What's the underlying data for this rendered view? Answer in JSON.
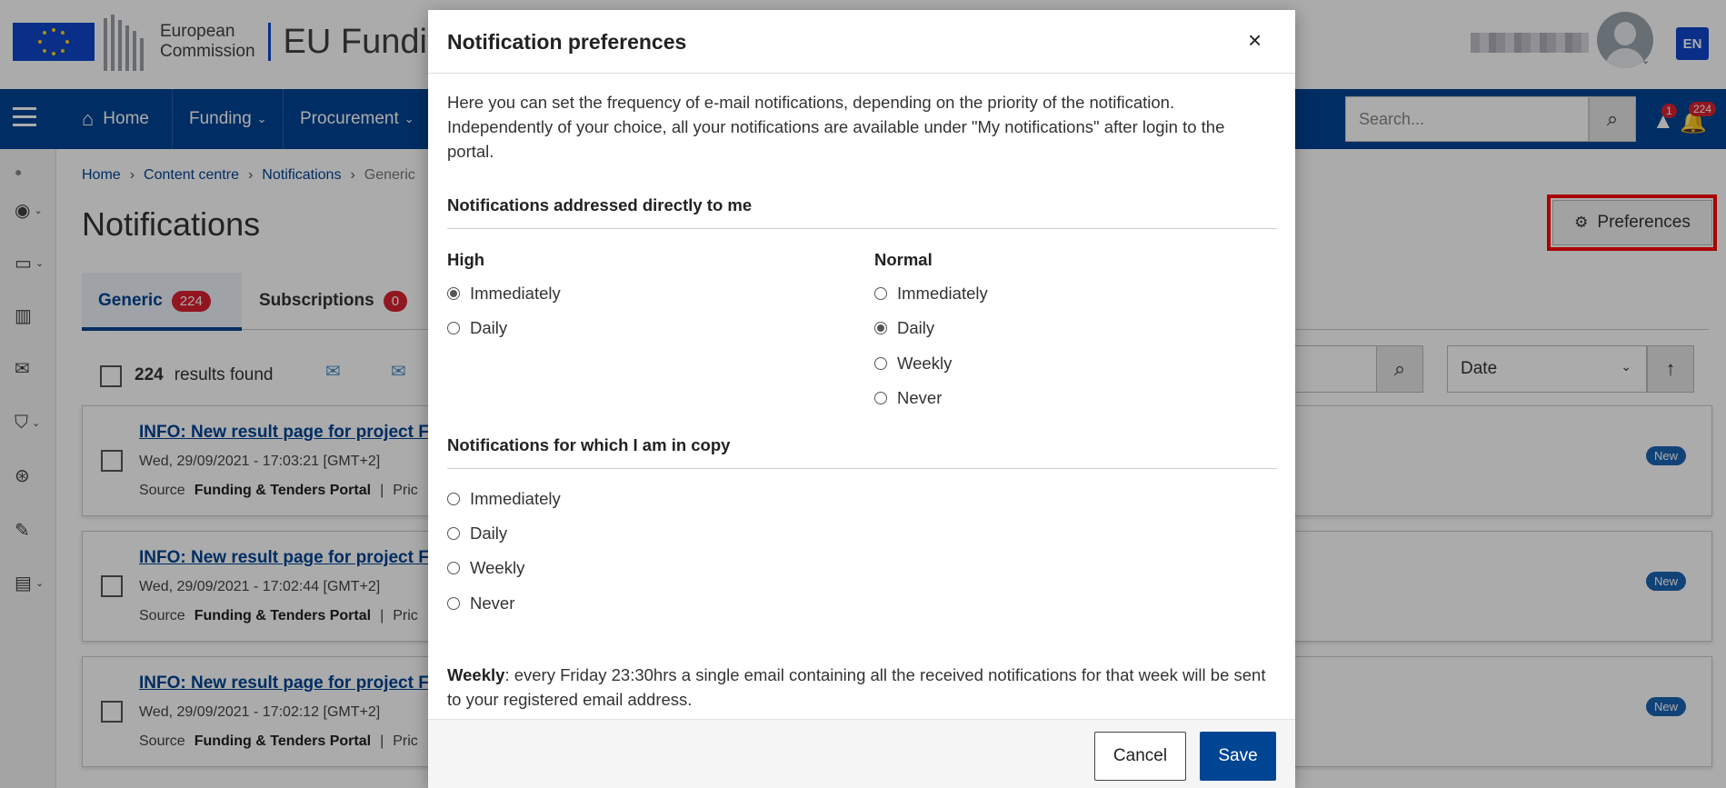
{
  "header": {
    "logo_line1": "European",
    "logo_line2": "Commission",
    "site_title": "EU Funding & Tenders Portal",
    "lang": "EN"
  },
  "nav": {
    "home": "Home",
    "funding": "Funding",
    "procurement": "Procurement",
    "search_placeholder": "Search...",
    "warn_count": "1",
    "bell_count": "224"
  },
  "breadcrumb": [
    "Home",
    "Content centre",
    "Notifications",
    "Generic"
  ],
  "page": {
    "title": "Notifications",
    "preferences_label": "Preferences"
  },
  "tabs": [
    {
      "label": "Generic",
      "count": "224"
    },
    {
      "label": "Subscriptions",
      "count": "0"
    }
  ],
  "list": {
    "results_count": "224",
    "results_label": "results found",
    "sort_value": "Date",
    "items": [
      {
        "title": "INFO: New result page for project F",
        "date": "Wed, 29/09/2021 - 17:03:21 [GMT+2]",
        "source_label": "Source",
        "source": "Funding & Tenders Portal",
        "extra": "Pric",
        "badge": "New"
      },
      {
        "title": "INFO: New result page for project F",
        "date": "Wed, 29/09/2021 - 17:02:44 [GMT+2]",
        "source_label": "Source",
        "source": "Funding & Tenders Portal",
        "extra": "Pric",
        "badge": "New"
      },
      {
        "title": "INFO: New result page for project F",
        "date": "Wed, 29/09/2021 - 17:02:12 [GMT+2]",
        "source_label": "Source",
        "source": "Funding & Tenders Portal",
        "extra": "Pric",
        "badge": "New"
      }
    ]
  },
  "modal": {
    "title": "Notification preferences",
    "intro": "Here you can set the frequency of e-mail notifications, depending on the priority of the notification. Independently of your choice, all your notifications are available under \"My notifications\" after login to the portal.",
    "section1": "Notifications addressed directly to me",
    "high_label": "High",
    "normal_label": "Normal",
    "high_options": [
      {
        "label": "Immediately",
        "checked": true
      },
      {
        "label": "Daily",
        "checked": false
      }
    ],
    "normal_options": [
      {
        "label": "Immediately",
        "checked": false
      },
      {
        "label": "Daily",
        "checked": true
      },
      {
        "label": "Weekly",
        "checked": false
      },
      {
        "label": "Never",
        "checked": false
      }
    ],
    "section2": "Notifications for which I am in copy",
    "copy_options": [
      {
        "label": "Immediately",
        "checked": false
      },
      {
        "label": "Daily",
        "checked": false
      },
      {
        "label": "Weekly",
        "checked": false
      },
      {
        "label": "Never",
        "checked": false
      }
    ],
    "note_bold": "Weekly",
    "note_text": ": every Friday 23:30hrs a single email containing all the received notifications for that week will be sent to your registered email address.",
    "cancel_label": "Cancel",
    "save_label": "Save"
  },
  "colors": {
    "primary": "#004494",
    "badge_red": "#da2131",
    "highlight": "#ff0000"
  }
}
